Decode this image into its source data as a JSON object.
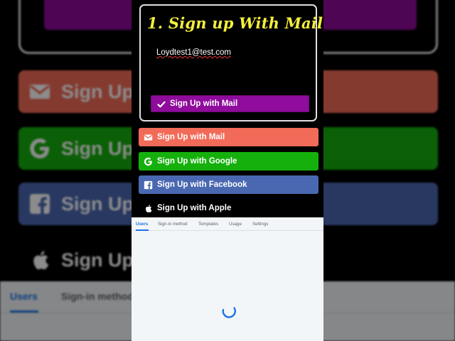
{
  "card": {
    "title": "1. Sign up With Mail",
    "email_value": "Loydtest1@test.com",
    "submit_label": "Sign Up with Mail"
  },
  "buttons": {
    "email": "Sign Up with Mail",
    "google": "Sign Up with Google",
    "facebook": "Sign Up with Facebook",
    "apple": "Sign Up with Apple"
  },
  "console": {
    "tabs": [
      {
        "label": "Users",
        "active": true
      },
      {
        "label": "Sign-in method",
        "active": false
      },
      {
        "label": "Templates",
        "active": false
      },
      {
        "label": "Usage",
        "active": false
      },
      {
        "label": "Settings",
        "active": false
      }
    ],
    "loading": true
  },
  "background": {
    "button_label": "Sign Up",
    "tab_users": "Users",
    "tab_signin": "Sign-in method"
  },
  "icons": {
    "check": "check-icon",
    "email": "envelope-icon",
    "google": "google-icon",
    "facebook": "facebook-icon",
    "apple": "apple-icon",
    "spinner": "loading-spinner-icon"
  },
  "colors": {
    "title_yellow": "#f5ef3b",
    "mail_purple": "#8f0c9c",
    "email_red": "#f26b58",
    "google_green": "#16b00d",
    "facebook_blue": "#4a68b1",
    "accent_blue": "#1a73e8"
  }
}
